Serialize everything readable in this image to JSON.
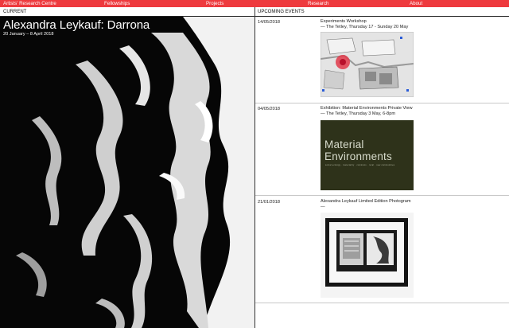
{
  "nav": {
    "items": [
      {
        "label": "Artists' Research Centre"
      },
      {
        "label": "Fellowships"
      },
      {
        "label": "Projects"
      },
      {
        "label": "Research"
      },
      {
        "label": "About"
      }
    ]
  },
  "sections": {
    "current_label": "CURRENT",
    "upcoming_label": "UPCOMING EVENTS"
  },
  "hero": {
    "title": "Alexandra Leykauf: Darrona",
    "dates": "20 January – 8 April 2018"
  },
  "events": [
    {
      "date": "14/05/2018",
      "title": "Experiments Workshop",
      "subtitle": "— The Tetley, Thursday 17 - Sunday 20 May",
      "image": "map-plan"
    },
    {
      "date": "04/05/2018",
      "title": "Exhibition: Material Environments Private View",
      "subtitle": "— The Tetley, Thursday 3 May, 6-8pm",
      "image": "material-poster",
      "poster_text": "Material Environments",
      "poster_sub": "social ecology · materiality · commons · rural · new communities"
    },
    {
      "date": "21/01/2018",
      "title": "Alexandra Leykauf Limited Edition Photogram",
      "subtitle": "—",
      "image": "framed-photogram"
    }
  ],
  "colors": {
    "accent": "#ee3a3e",
    "poster_bg": "#2e321a"
  }
}
